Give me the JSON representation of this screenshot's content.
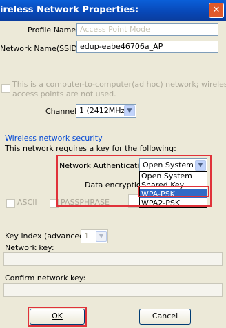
{
  "dialog": {
    "title": "ireless Network Properties:",
    "close_glyph": "✕"
  },
  "profile": {
    "label": "Profile Name:",
    "placeholder": "Access Point Mode"
  },
  "ssid": {
    "label": "Network Name(SSID):",
    "value": "edup-eabe46706a_AP"
  },
  "adhoc": {
    "line1": "This is a computer-to-computer(ad hoc) network; wireless",
    "line2": "access points are not used."
  },
  "channel": {
    "label": "Channel:",
    "value": "1 (2412MHz)"
  },
  "security": {
    "group_title": "Wireless network security",
    "description": "This network requires a key for the following:",
    "auth_label": "Network Authentication:",
    "auth_value": "Open System",
    "auth_options": [
      "Open System",
      "Shared Key",
      "WPA-PSK",
      "WPA2-PSK"
    ],
    "auth_selected_index": 2,
    "encryption_label": "Data encryption:",
    "ascii_label": "ASCII",
    "passphrase_label": "PASSPHRASE"
  },
  "key_index": {
    "label": "Key index (advanced):",
    "value": "1"
  },
  "network_key": {
    "label": "Network key:"
  },
  "confirm_key": {
    "label": "Confirm network key:"
  },
  "buttons": {
    "ok": "OK",
    "cancel": "Cancel"
  },
  "colors": {
    "highlight_box": "#e0323a",
    "selection": "#316ac5",
    "titlebar": "#0a5fd8"
  }
}
